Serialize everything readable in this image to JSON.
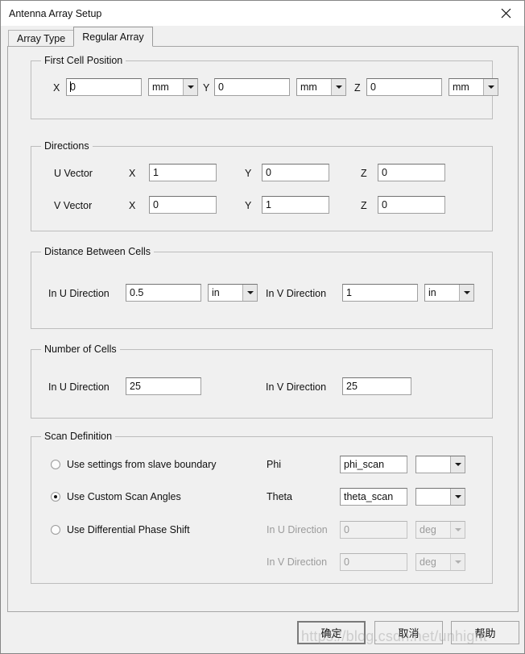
{
  "window": {
    "title": "Antenna Array Setup",
    "close_icon": "close-icon"
  },
  "tabs": [
    {
      "label": "Array Type",
      "active": false
    },
    {
      "label": "Regular Array",
      "active": true
    }
  ],
  "groups": {
    "first_cell_position": {
      "title": "First Cell Position",
      "fields": [
        {
          "label": "X",
          "value": "0",
          "unit": "mm"
        },
        {
          "label": "Y",
          "value": "0",
          "unit": "mm"
        },
        {
          "label": "Z",
          "value": "0",
          "unit": "mm"
        }
      ]
    },
    "directions": {
      "title": "Directions",
      "rows": [
        {
          "label": "U Vector",
          "x_label": "X",
          "x_value": "1",
          "y_label": "Y",
          "y_value": "0",
          "z_label": "Z",
          "z_value": "0"
        },
        {
          "label": "V Vector",
          "x_label": "X",
          "x_value": "0",
          "y_label": "Y",
          "y_value": "1",
          "z_label": "Z",
          "z_value": "0"
        }
      ]
    },
    "distance_between_cells": {
      "title": "Distance Between Cells",
      "u_label": "In U Direction",
      "u_value": "0.5",
      "u_unit": "in",
      "v_label": "In V Direction",
      "v_value": "1",
      "v_unit": "in"
    },
    "number_of_cells": {
      "title": "Number of Cells",
      "u_label": "In U Direction",
      "u_value": "25",
      "v_label": "In V Direction",
      "v_value": "25"
    },
    "scan_definition": {
      "title": "Scan Definition",
      "options": [
        {
          "label": "Use settings from slave boundary",
          "checked": false
        },
        {
          "label": "Use Custom Scan Angles",
          "checked": true
        },
        {
          "label": "Use Differential Phase Shift",
          "checked": false
        }
      ],
      "phi_label": "Phi",
      "phi_value": "phi_scan",
      "phi_unit": "",
      "theta_label": "Theta",
      "theta_value": "theta_scan",
      "theta_unit": "",
      "u_label": "In U Direction",
      "u_value": "0",
      "u_unit": "deg",
      "v_label": "In V Direction",
      "v_value": "0",
      "v_unit": "deg"
    }
  },
  "footer": {
    "ok_label": "确定",
    "cancel_label": "取消",
    "help_label": "帮助"
  },
  "watermark": "https://blog.csdn.net/unhight"
}
